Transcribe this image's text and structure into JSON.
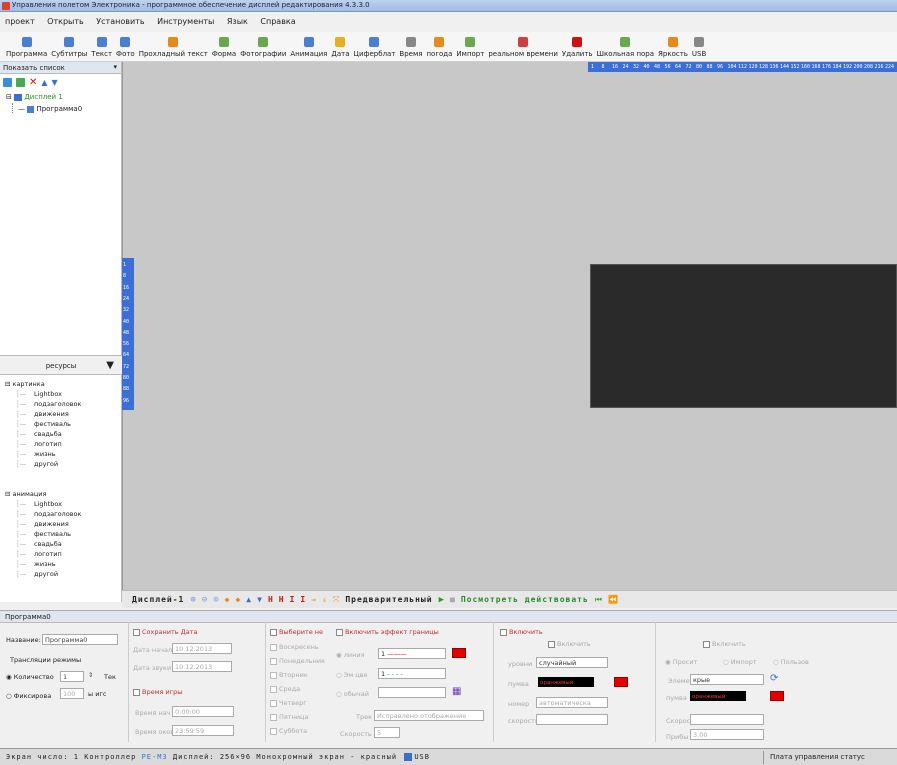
{
  "window": {
    "title": "Управления полетом Электроника - программное обеспечение дисплей редактирования 4.3.3.0"
  },
  "menu": [
    "проект",
    "Открыть",
    "Установить",
    "Инструменты",
    "Язык",
    "Справка"
  ],
  "toolbar": [
    {
      "label": "Программа",
      "color": "#4a7fd4"
    },
    {
      "label": "Субтитры",
      "color": "#4a7fd4"
    },
    {
      "label": "Текст",
      "color": "#4a7fd4"
    },
    {
      "label": "Фото",
      "color": "#4a7fd4"
    },
    {
      "label": "Прохладный текст",
      "color": "#e88a1a"
    },
    {
      "label": "Форма",
      "color": "#6aa84f"
    },
    {
      "label": "Фотографии",
      "color": "#6aa84f"
    },
    {
      "label": "Анимация",
      "color": "#4a7fd4"
    },
    {
      "label": "Дата",
      "color": "#e8b020"
    },
    {
      "label": "Циферблат",
      "color": "#4a7fd4"
    },
    {
      "label": "Время",
      "color": "#888888"
    },
    {
      "label": "погода",
      "color": "#e88a1a"
    },
    {
      "label": "Импорт",
      "color": "#6aa84f"
    },
    {
      "label": "реальном времени",
      "color": "#d04040"
    },
    {
      "label": "Удалить",
      "color": "#d01010"
    },
    {
      "label": "Школьная пора",
      "color": "#6aa84f"
    },
    {
      "label": "Яркость",
      "color": "#e88a1a"
    },
    {
      "label": "USB",
      "color": "#888888"
    }
  ],
  "left": {
    "header": "Показать список",
    "tree_root": "Дисплей 1",
    "tree_child": "Программа0",
    "resources_label": "ресурсы",
    "cat1": "картинка",
    "cat2": "анимация",
    "items1": [
      "Lightbox",
      "подзаголовок",
      "движения",
      "фестиваль",
      "свадьба",
      "логотип",
      "жизнь",
      "другой"
    ],
    "items2": [
      "Lightbox",
      "подзаголовок",
      "движения",
      "фестиваль",
      "свадьба",
      "логотип",
      "жизнь",
      "другой"
    ]
  },
  "ruler": {
    "top": [
      "1",
      "8",
      "16",
      "24",
      "32",
      "40",
      "48",
      "56",
      "64",
      "72",
      "80",
      "88",
      "96",
      "104",
      "112",
      "120",
      "128",
      "136",
      "144",
      "152",
      "160",
      "168",
      "176",
      "184",
      "192",
      "200",
      "208",
      "216",
      "224"
    ],
    "left": [
      "1",
      "8",
      "16",
      "24",
      "32",
      "40",
      "48",
      "56",
      "64",
      "72",
      "80",
      "88",
      "96"
    ]
  },
  "preview": {
    "display": "Дисплей-1",
    "label": "Предварительный",
    "action": "Посмотреть действовать"
  },
  "props": {
    "header": "Программа0",
    "name_label": "Название:",
    "name_value": "Программа0",
    "mode_label": "Трансляции режимы",
    "qty_label": "Количество",
    "qty_value": "1",
    "qty_unit": "Тек",
    "fixed_label": "Фиксирова",
    "fixed_value": "100",
    "fixed_unit": "ы игс",
    "date_check": "Сохранить Дата",
    "date_start_label": "Дата начала",
    "date_start": "10.12.2013",
    "date_end_label": "Дата звуки",
    "date_end": "10.12.2013",
    "time_check": "Время игры",
    "time_start_label": "Время нач",
    "time_start": "0:00:00",
    "time_end_label": "Время оков",
    "time_end": "23:59:59",
    "week_check": "Выберите не",
    "days": [
      "Воскресень",
      "Понедельник",
      "Вторник",
      "Среда",
      "Четверг",
      "Пятница",
      "Суббота"
    ],
    "border_check": "Включить эффект границы",
    "border_r1": "линия",
    "border_r1_val": "1",
    "border_r2": "Эм цве",
    "border_r2_val": "1",
    "border_r3": "обычай",
    "track_label": "Трек",
    "track_value": "Исправлено отображение",
    "speed_label": "Скорость",
    "speed_value": "5",
    "enable_check": "Включить",
    "sub_enable": "Включить",
    "level_label": "уровни",
    "level_value": "случайный",
    "color_label": "пумва",
    "color_value": "оранжевый",
    "number_label": "номер",
    "number_value": "автоматическа",
    "speed2_label": "скорость",
    "enable_check2": "Включить",
    "radio_a": "Просит",
    "radio_b": "Импорт",
    "radio_c": "Пользов",
    "elem_label": "Элемент",
    "elem_value": "крые",
    "color2_label": "пумва",
    "color2_value": "оранжевый",
    "speed3_label": "Скорость",
    "period_label": "Прибы",
    "period_value": "3.00",
    "red": "#e30000"
  },
  "status": {
    "text": "Экран число: 1 Контроллер",
    "model": "PE-M3",
    "disp": "Дисплей:",
    "size": "256×96",
    "mode": "Монохромный экран - красный",
    "usb": "USB",
    "right": "Плата управления статус"
  }
}
